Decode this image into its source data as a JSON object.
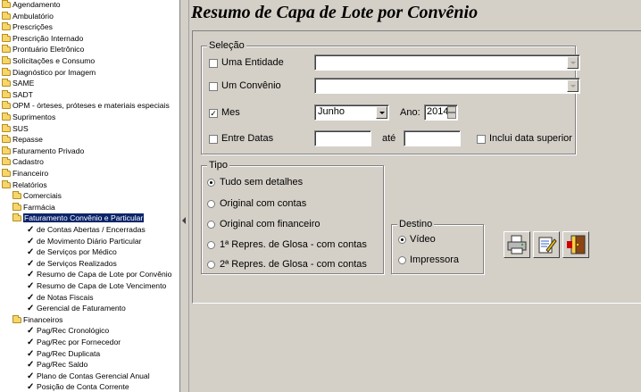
{
  "tree": {
    "items": [
      {
        "label": "Agendamento",
        "type": "folder",
        "level": 0
      },
      {
        "label": "Ambulatório",
        "type": "folder",
        "level": 0
      },
      {
        "label": "Prescrições",
        "type": "folder",
        "level": 0
      },
      {
        "label": "Prescrição Internado",
        "type": "folder",
        "level": 0
      },
      {
        "label": "Prontuário Eletrônico",
        "type": "folder",
        "level": 0
      },
      {
        "label": "Solicitações e Consumo",
        "type": "folder",
        "level": 0
      },
      {
        "label": "Diagnóstico por Imagem",
        "type": "folder",
        "level": 0
      },
      {
        "label": "SAME",
        "type": "folder",
        "level": 0
      },
      {
        "label": "SADT",
        "type": "folder",
        "level": 0
      },
      {
        "label": "OPM - órteses, próteses e materiais especiais",
        "type": "folder",
        "level": 0
      },
      {
        "label": "Suprimentos",
        "type": "folder",
        "level": 0
      },
      {
        "label": "SUS",
        "type": "folder",
        "level": 0
      },
      {
        "label": "Repasse",
        "type": "folder",
        "level": 0
      },
      {
        "label": "Faturamento Privado",
        "type": "folder",
        "level": 0
      },
      {
        "label": "Cadastro",
        "type": "folder",
        "level": 0
      },
      {
        "label": "Financeiro",
        "type": "folder",
        "level": 0
      },
      {
        "label": "Relatórios",
        "type": "folder",
        "level": 0
      },
      {
        "label": "Comerciais",
        "type": "folder",
        "level": 1
      },
      {
        "label": "Farmácia",
        "type": "folder",
        "level": 1
      },
      {
        "label": "Faturamento Convênio e Particular",
        "type": "folder",
        "level": 1,
        "selected": true
      },
      {
        "label": "de Contas Abertas / Encerradas",
        "type": "check",
        "level": 2
      },
      {
        "label": "de Movimento Diário Particular",
        "type": "check",
        "level": 2
      },
      {
        "label": "de Serviços por Médico",
        "type": "check",
        "level": 2
      },
      {
        "label": "de Serviços Realizados",
        "type": "check",
        "level": 2
      },
      {
        "label": "Resumo de Capa de Lote por Convênio",
        "type": "check",
        "level": 2
      },
      {
        "label": "Resumo de Capa de Lote Vencimento",
        "type": "check",
        "level": 2
      },
      {
        "label": "de Notas Fiscais",
        "type": "check",
        "level": 2
      },
      {
        "label": "Gerencial de Faturamento",
        "type": "check",
        "level": 2
      },
      {
        "label": "Financeiros",
        "type": "folder",
        "level": 1
      },
      {
        "label": "Pag/Rec Cronológico",
        "type": "check",
        "level": 2
      },
      {
        "label": "Pag/Rec por Fornecedor",
        "type": "check",
        "level": 2
      },
      {
        "label": "Pag/Rec Duplicata",
        "type": "check",
        "level": 2
      },
      {
        "label": "Pag/Rec Saldo",
        "type": "check",
        "level": 2
      },
      {
        "label": "Plano de Contas Gerencial Anual",
        "type": "check",
        "level": 2
      },
      {
        "label": "Posição de Conta Corrente",
        "type": "check",
        "level": 2
      }
    ]
  },
  "page": {
    "title": "Resumo de Capa de Lote por Convênio"
  },
  "selecao": {
    "legend": "Seleção",
    "uma_entidade": {
      "label": "Uma Entidade",
      "checked": false,
      "value": ""
    },
    "um_convenio": {
      "label": "Um Convênio",
      "checked": false,
      "value": ""
    },
    "mes": {
      "label": "Mes",
      "checked": true,
      "value": "Junho"
    },
    "ano": {
      "label": "Ano:",
      "value": "2014"
    },
    "entre_datas": {
      "label": "Entre Datas",
      "checked": false,
      "from": "",
      "to": "",
      "sep": "até"
    },
    "inclui": {
      "label": "Inclui data superior",
      "checked": false
    }
  },
  "tipo": {
    "legend": "Tipo",
    "options": [
      {
        "label": "Tudo sem detalhes",
        "selected": true
      },
      {
        "label": "Original com contas",
        "selected": false
      },
      {
        "label": "Original com financeiro",
        "selected": false
      },
      {
        "label": "1ª Repres. de Glosa - com contas",
        "selected": false
      },
      {
        "label": "2ª Repres. de Glosa - com contas",
        "selected": false
      }
    ]
  },
  "destino": {
    "legend": "Destino",
    "options": [
      {
        "label": "Vídeo",
        "selected": true
      },
      {
        "label": "Impressora",
        "selected": false
      }
    ]
  },
  "toolbar": {
    "buttons": [
      {
        "name": "print-icon"
      },
      {
        "name": "edit-icon"
      },
      {
        "name": "exit-door-icon"
      }
    ]
  }
}
